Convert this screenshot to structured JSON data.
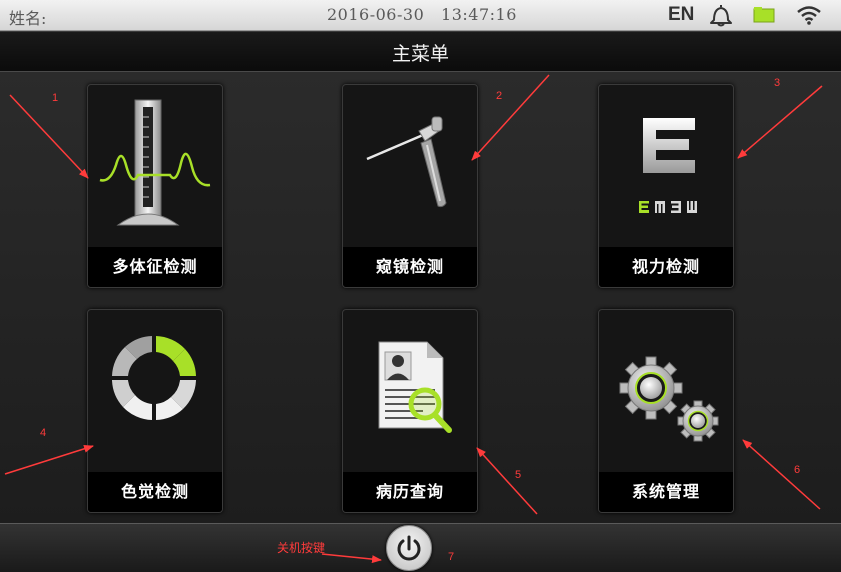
{
  "status_bar": {
    "patient_label": "姓名:",
    "date": "2016-06-30",
    "time": "13:47:16",
    "language": "EN",
    "icons": [
      "bell-icon",
      "battery-icon",
      "wifi-icon"
    ]
  },
  "header": {
    "title": "主菜单"
  },
  "menu": {
    "tiles": [
      {
        "label": "多体征检测",
        "icon": "vital-signs-icon"
      },
      {
        "label": "窥镜检测",
        "icon": "otoscope-icon"
      },
      {
        "label": "视力检测",
        "icon": "eye-chart-icon"
      },
      {
        "label": "色觉检测",
        "icon": "color-wheel-icon"
      },
      {
        "label": "病历查询",
        "icon": "medical-record-search-icon"
      },
      {
        "label": "系统管理",
        "icon": "gears-icon"
      }
    ]
  },
  "footer": {
    "power_icon": "power-icon"
  },
  "annotations": {
    "numbers": [
      "1",
      "2",
      "3",
      "4",
      "5",
      "6",
      "7"
    ],
    "power_note": "关机按键",
    "color": "#ff3b3b"
  },
  "colors": {
    "accent_green": "#a8e028",
    "background": "#1e1e1e"
  }
}
